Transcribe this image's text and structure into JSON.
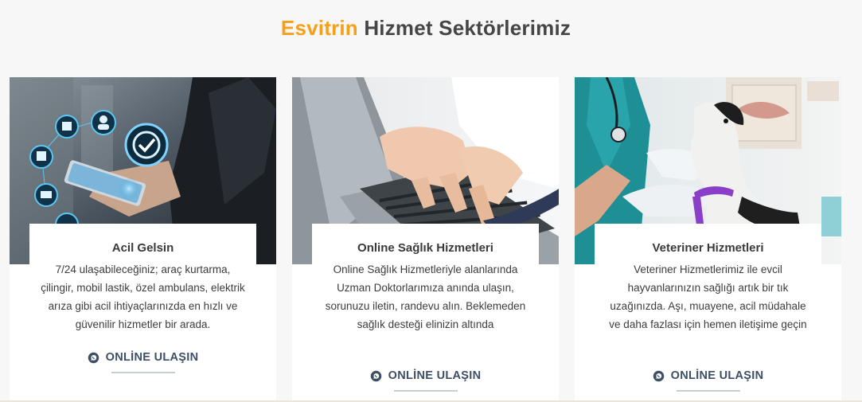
{
  "heading": {
    "accent": "Esvitrin",
    "rest": " Hizmet Sektörlerimiz",
    "accent_color": "#f5a018"
  },
  "cards": [
    {
      "image_icon": "emergency-services-tablet-image",
      "title": "Acil Gelsin",
      "description": "7/24 ulaşabileceğiniz; araç kurtarma, çilingir, mobil lastik, özel ambulans, elektrik arıza gibi acil ihtiyaçlarınızda en hızlı ve güvenilir hizmetler bir arada.",
      "cta": "ONLİNE ULAŞIN",
      "cta_icon": "whatsapp-icon"
    },
    {
      "image_icon": "doctor-laptop-image",
      "title": "Online Sağlık Hizmetleri",
      "description": "Online Sağlık Hizmetleriyle alanlarında Uzman Doktorlarımıza anında ulaşın, sorunuzu iletin, randevu alın. Beklemeden sağlık desteği elinizin altında",
      "cta": "ONLİNE ULAŞIN",
      "cta_icon": "whatsapp-icon"
    },
    {
      "image_icon": "veterinarian-dog-image",
      "title": "Veteriner Hizmetleri",
      "description": "Veteriner Hizmetlerimiz ile evcil hayvanlarınızın sağlığı artık bir tık uzağınızda. Aşı, muayene, acil müdahale ve daha fazlası için hemen iletişime geçin",
      "cta": "ONLİNE ULAŞIN",
      "cta_icon": "whatsapp-icon"
    }
  ]
}
